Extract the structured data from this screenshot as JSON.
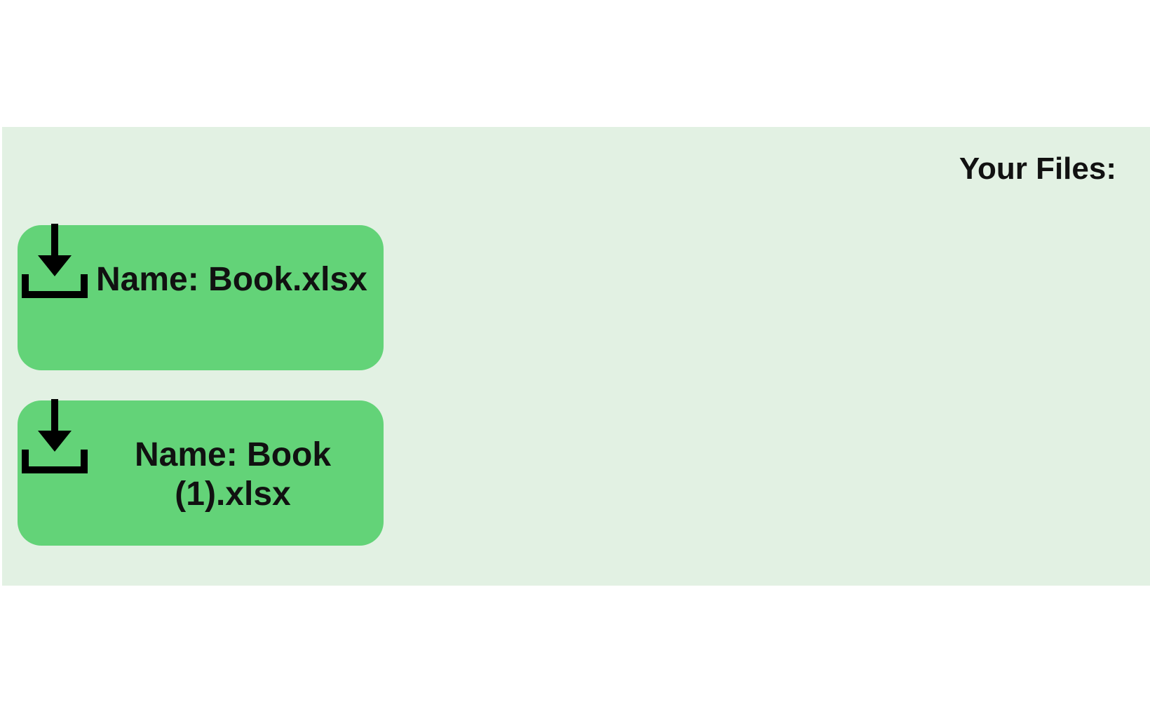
{
  "panel": {
    "title": "Your Files:",
    "background_color": "#e2f1e3"
  },
  "files": [
    {
      "name_label": "Name: Book.xlsx",
      "icon": "download-icon",
      "card_color": "#63d378"
    },
    {
      "name_label_line1": "Name: Book",
      "name_label_line2": "(1).xlsx",
      "icon": "download-icon",
      "card_color": "#63d378"
    }
  ]
}
